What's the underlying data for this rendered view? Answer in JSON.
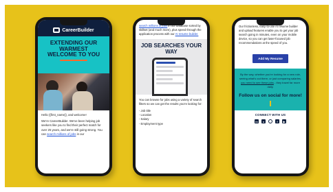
{
  "phone1": {
    "brand": "CareerBuilder",
    "headline_1": "EXTENDING OUR",
    "headline_2": "WARMEST",
    "headline_3": "WELCOME TO YOU",
    "greeting": "Hello {{first_name}}, and welcome!",
    "para_1": "We're CareerBuilder. We've been helping job seekers like you to find their perfect match for over 25 years, and we're still going strong. You can",
    "link": "search millions of jobs",
    "para_1_end": "in our"
  },
  "phone2": {
    "top_link": "search millions of jobs",
    "top_text": "in our database sorted by skillset (and much more), plus speed through the application process with our",
    "top_link_2": "AI resume builder.",
    "heading": "JOB SEARCHES YOUR WAY",
    "body_intro": "You can browse for jobs using a variety of search filters so we can get the results you're looking for:",
    "filters": [
      "- Job title",
      "- Location",
      "- Salary",
      "- Employment type"
    ]
  },
  "phone3": {
    "top_text": "Our frictionless, easy-to-use AI resume builder and upload features enable you to get your job search going in minutes, even on your mobile device, so you can get laser-focused job recommendations at the speed of you.",
    "button": "Add My Resume",
    "teal_text_1": "By the way, whether you're looking for a new role, seeing what's out there, or just comparing salaries,",
    "teal_link": "you need to see these jobs",
    "teal_text_2": "- they travel far more daily.",
    "follow": "Follow us on social for more!",
    "connect": "CONNECT WITH US",
    "social_icons": [
      "linkedin-icon",
      "twitter-icon",
      "instagram-icon",
      "facebook-icon",
      "youtube-icon"
    ]
  },
  "colors": {
    "background": "#e7c21a",
    "navy": "#0f1f3d",
    "teal": "#17c2c5",
    "button": "#2941a8",
    "accent": "#ff6a2a"
  }
}
